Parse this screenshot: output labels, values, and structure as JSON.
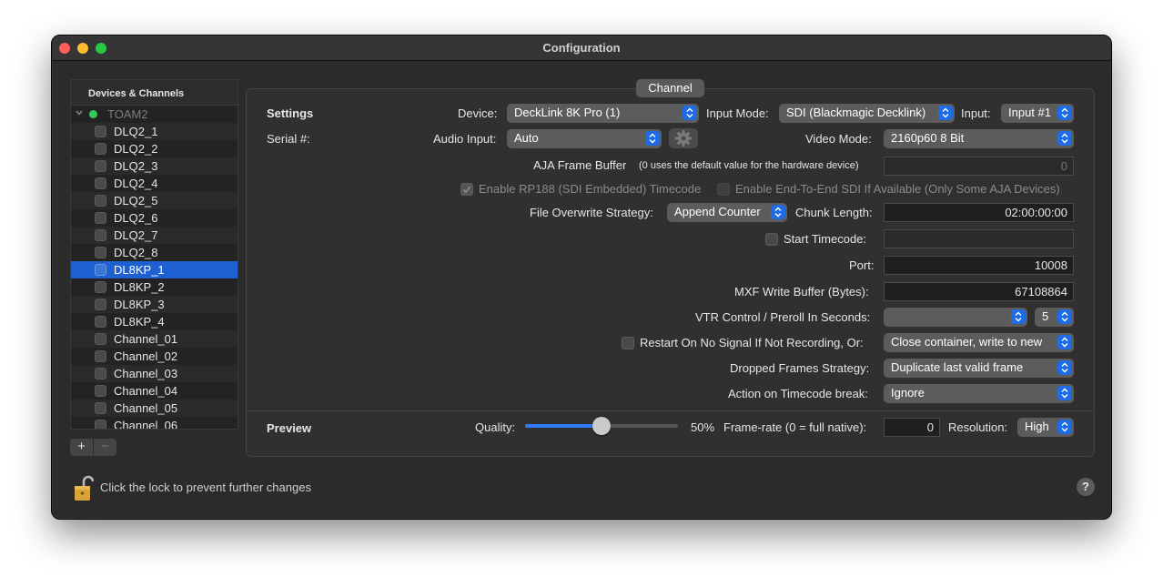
{
  "window": {
    "title": "Configuration"
  },
  "sidebar": {
    "header": "Devices & Channels",
    "group": "TOAM2",
    "items": [
      {
        "label": "DLQ2_1"
      },
      {
        "label": "DLQ2_2"
      },
      {
        "label": "DLQ2_3"
      },
      {
        "label": "DLQ2_4"
      },
      {
        "label": "DLQ2_5"
      },
      {
        "label": "DLQ2_6"
      },
      {
        "label": "DLQ2_7"
      },
      {
        "label": "DLQ2_8"
      },
      {
        "label": "DL8KP_1"
      },
      {
        "label": "DL8KP_2"
      },
      {
        "label": "DL8KP_3"
      },
      {
        "label": "DL8KP_4"
      },
      {
        "label": "Channel_01"
      },
      {
        "label": "Channel_02"
      },
      {
        "label": "Channel_03"
      },
      {
        "label": "Channel_04"
      },
      {
        "label": "Channel_05"
      },
      {
        "label": "Channel_06"
      }
    ],
    "selected": "DL8KP_1",
    "add_label": "+",
    "remove_label": "−"
  },
  "channel_tab": "Channel",
  "settings": {
    "section_label": "Settings",
    "device_label": "Device:",
    "device_value": "DeckLink 8K Pro (1)",
    "input_mode_label": "Input Mode:",
    "input_mode_value": "SDI (Blackmagic Decklink)",
    "input_label": "Input:",
    "input_value": "Input #1",
    "serial_label": "Serial #:",
    "audio_input_label": "Audio Input:",
    "audio_input_value": "Auto",
    "video_mode_label": "Video Mode:",
    "video_mode_value": "2160p60 8 Bit",
    "aja_label": "AJA Frame Buffer",
    "aja_hint": "(0 uses the default value for the hardware device)",
    "aja_value": "0",
    "rp188_label": "Enable RP188 (SDI Embedded) Timecode",
    "e2e_label": "Enable End-To-End SDI If Available (Only Some AJA Devices)",
    "overwrite_label": "File Overwrite Strategy:",
    "overwrite_value": "Append Counter",
    "chunk_label": "Chunk Length:",
    "chunk_value": "02:00:00:00",
    "start_tc_label": "Start Timecode:",
    "start_tc_value": "",
    "port_label": "Port:",
    "port_value": "10008",
    "mxf_label": "MXF Write Buffer (Bytes):",
    "mxf_value": "67108864",
    "vtr_label": "VTR Control / Preroll In Seconds:",
    "vtr_value": "",
    "preroll_value": "5",
    "restart_label": "Restart On No Signal If Not Recording, Or:",
    "restart_value": "Close container, write to new",
    "dropped_label": "Dropped Frames Strategy:",
    "dropped_value": "Duplicate last valid frame",
    "tc_break_label": "Action on Timecode break:",
    "tc_break_value": "Ignore"
  },
  "preview": {
    "section_label": "Preview",
    "quality_label": "Quality:",
    "quality_fraction": 0.5,
    "quality_text": "50%",
    "framerate_label": "Frame-rate (0 = full native):",
    "framerate_value": "0",
    "resolution_label": "Resolution:",
    "resolution_value": "High"
  },
  "footer": {
    "lock_text": "Click the lock to prevent further changes",
    "help_label": "?"
  },
  "colors": {
    "accent": "#1e6be6",
    "selection": "#1e5fd1",
    "status_green": "#34c759"
  }
}
